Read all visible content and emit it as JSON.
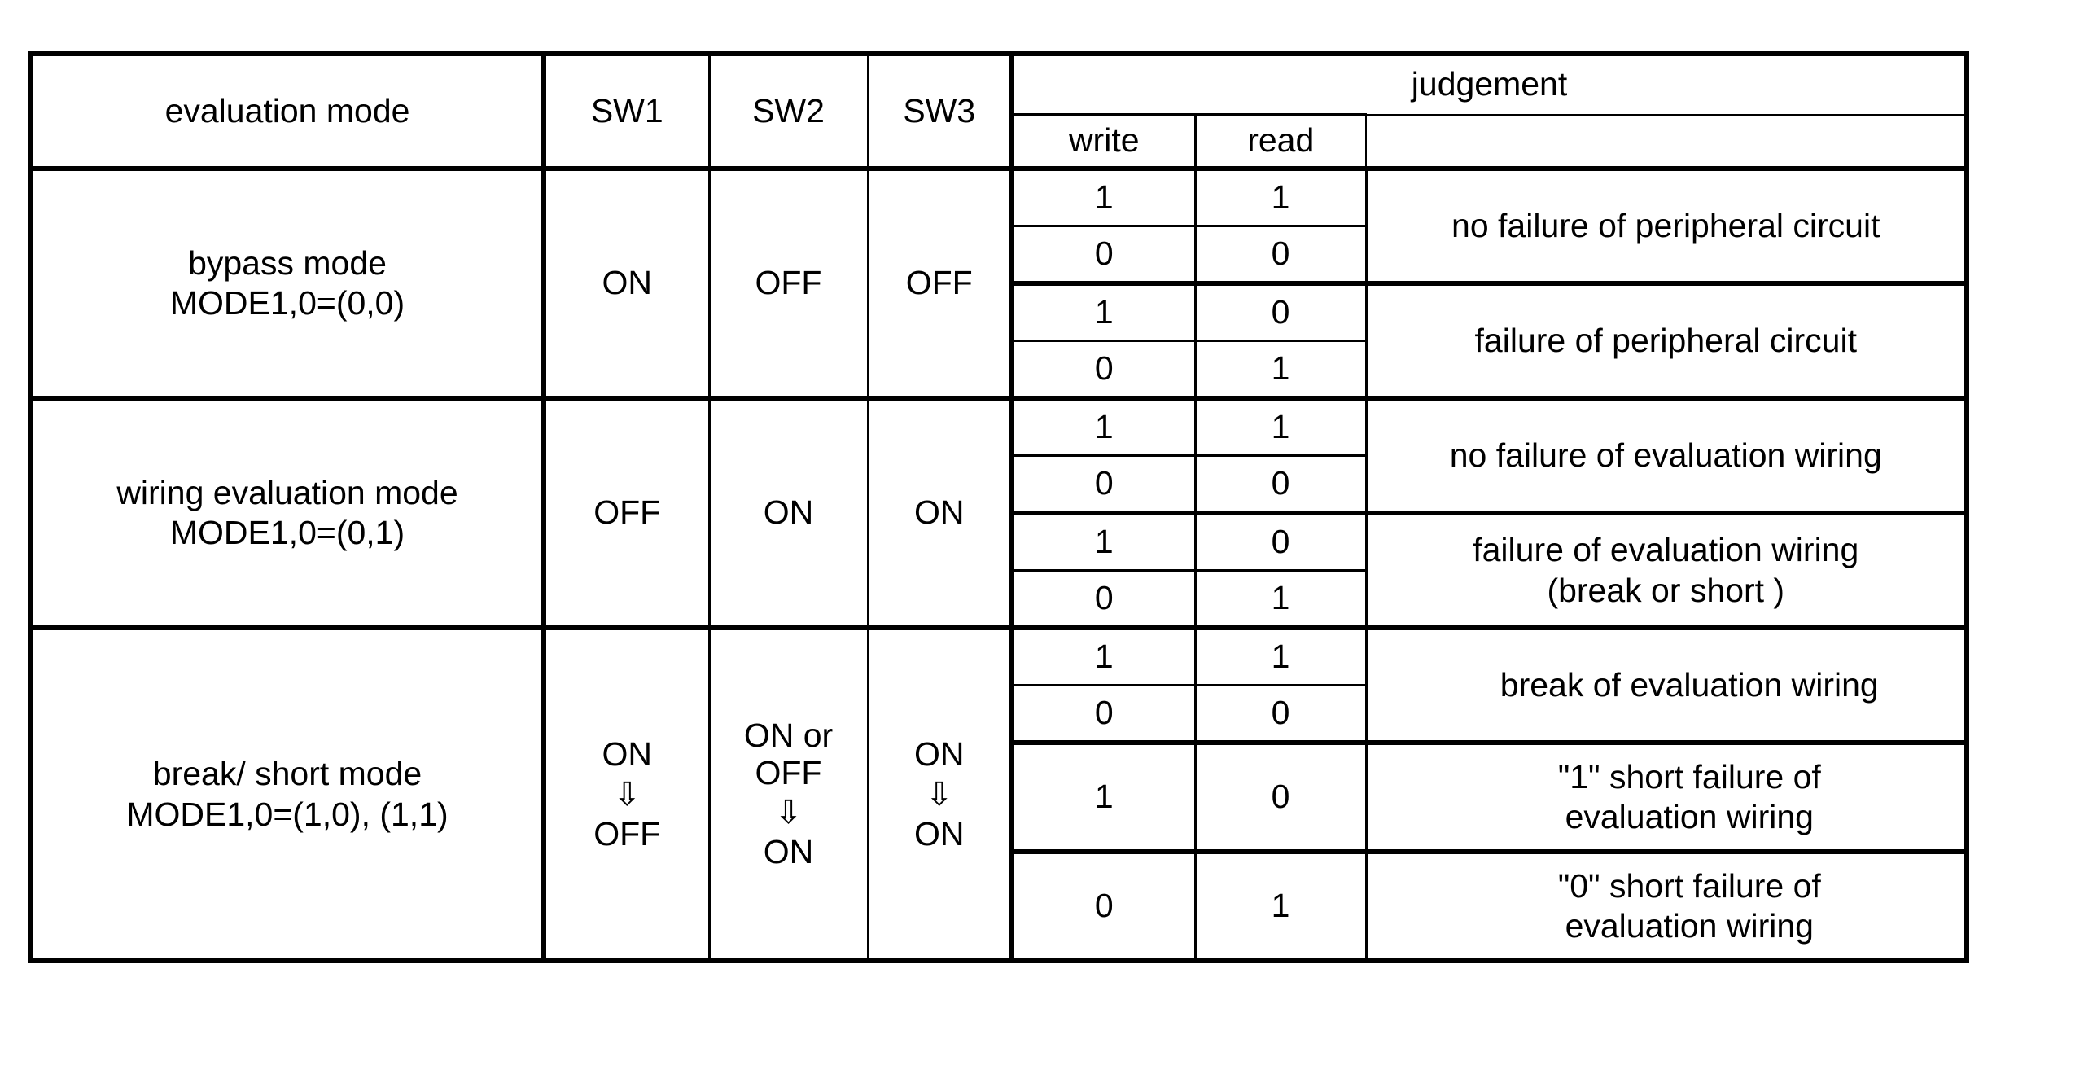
{
  "table": {
    "columns": {
      "evaluation_mode": "evaluation mode",
      "sw1": "SW1",
      "sw2": "SW2",
      "sw3": "SW3",
      "judgement": "judgement",
      "write": "write",
      "read": "read"
    },
    "sections": [
      {
        "mode_line1": "bypass mode",
        "mode_line2": "MODE1,0=(0,0)",
        "sw1": "ON",
        "sw2": "OFF",
        "sw3": "OFF",
        "rows": [
          {
            "write": "1",
            "read": "1"
          },
          {
            "write": "0",
            "read": "0"
          },
          {
            "write": "1",
            "read": "0"
          },
          {
            "write": "0",
            "read": "1"
          }
        ],
        "judgements": [
          {
            "line1": "no failure of peripheral circuit",
            "line2": "",
            "span": 2
          },
          {
            "line1": "failure of peripheral circuit",
            "line2": "",
            "span": 2
          }
        ]
      },
      {
        "mode_line1": "wiring evaluation mode",
        "mode_line2": "MODE1,0=(0,1)",
        "sw1": "OFF",
        "sw2": "ON",
        "sw3": "ON",
        "rows": [
          {
            "write": "1",
            "read": "1"
          },
          {
            "write": "0",
            "read": "0"
          },
          {
            "write": "1",
            "read": "0"
          },
          {
            "write": "0",
            "read": "1"
          }
        ],
        "judgements": [
          {
            "line1": "no failure of evaluation wiring",
            "line2": "",
            "span": 2
          },
          {
            "line1": "failure of evaluation wiring",
            "line2": "(break or short )",
            "span": 2
          }
        ]
      },
      {
        "mode_line1": "break/ short mode",
        "mode_line2": "MODE1,0=(1,0), (1,1)",
        "sw1_from": "ON",
        "sw1_arrow": "⇩",
        "sw1_to": "OFF",
        "sw2_from_a": "ON or",
        "sw2_from_b": "OFF",
        "sw2_arrow": "⇩",
        "sw2_to": "ON",
        "sw3_from": "ON",
        "sw3_arrow": "⇩",
        "sw3_to": "ON",
        "rows": [
          {
            "write": "1",
            "read": "1"
          },
          {
            "write": "0",
            "read": "0"
          },
          {
            "write": "1",
            "read": "0"
          },
          {
            "write": "0",
            "read": "1"
          }
        ],
        "judgements": [
          {
            "line1": "break of evaluation wiring",
            "line2": "",
            "span": 2
          },
          {
            "line1": "\"1\" short failure of",
            "line2": "evaluation wiring",
            "span": 1
          },
          {
            "line1": "\"0\" short failure of",
            "line2": "evaluation wiring",
            "span": 1
          }
        ]
      }
    ]
  }
}
